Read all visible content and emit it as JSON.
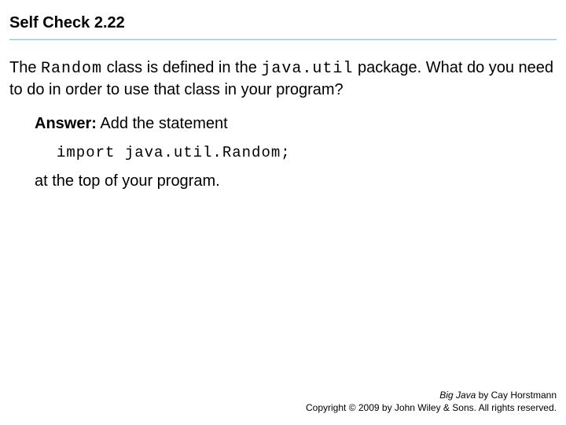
{
  "title": "Self Check 2.22",
  "question": {
    "part1": "The ",
    "code1": "Random",
    "part2": " class is defined in the ",
    "code2": "java.util",
    "part3": " package. What do you need to do in order to use that class in your program?"
  },
  "answer": {
    "label": "Answer:",
    "text": " Add the statement",
    "code": "import java.util.Random;",
    "closing": "at the top of your program."
  },
  "footer": {
    "book": "Big Java",
    "author": " by Cay Horstmann",
    "copyright": "Copyright © 2009 by John Wiley & Sons. All rights reserved."
  }
}
